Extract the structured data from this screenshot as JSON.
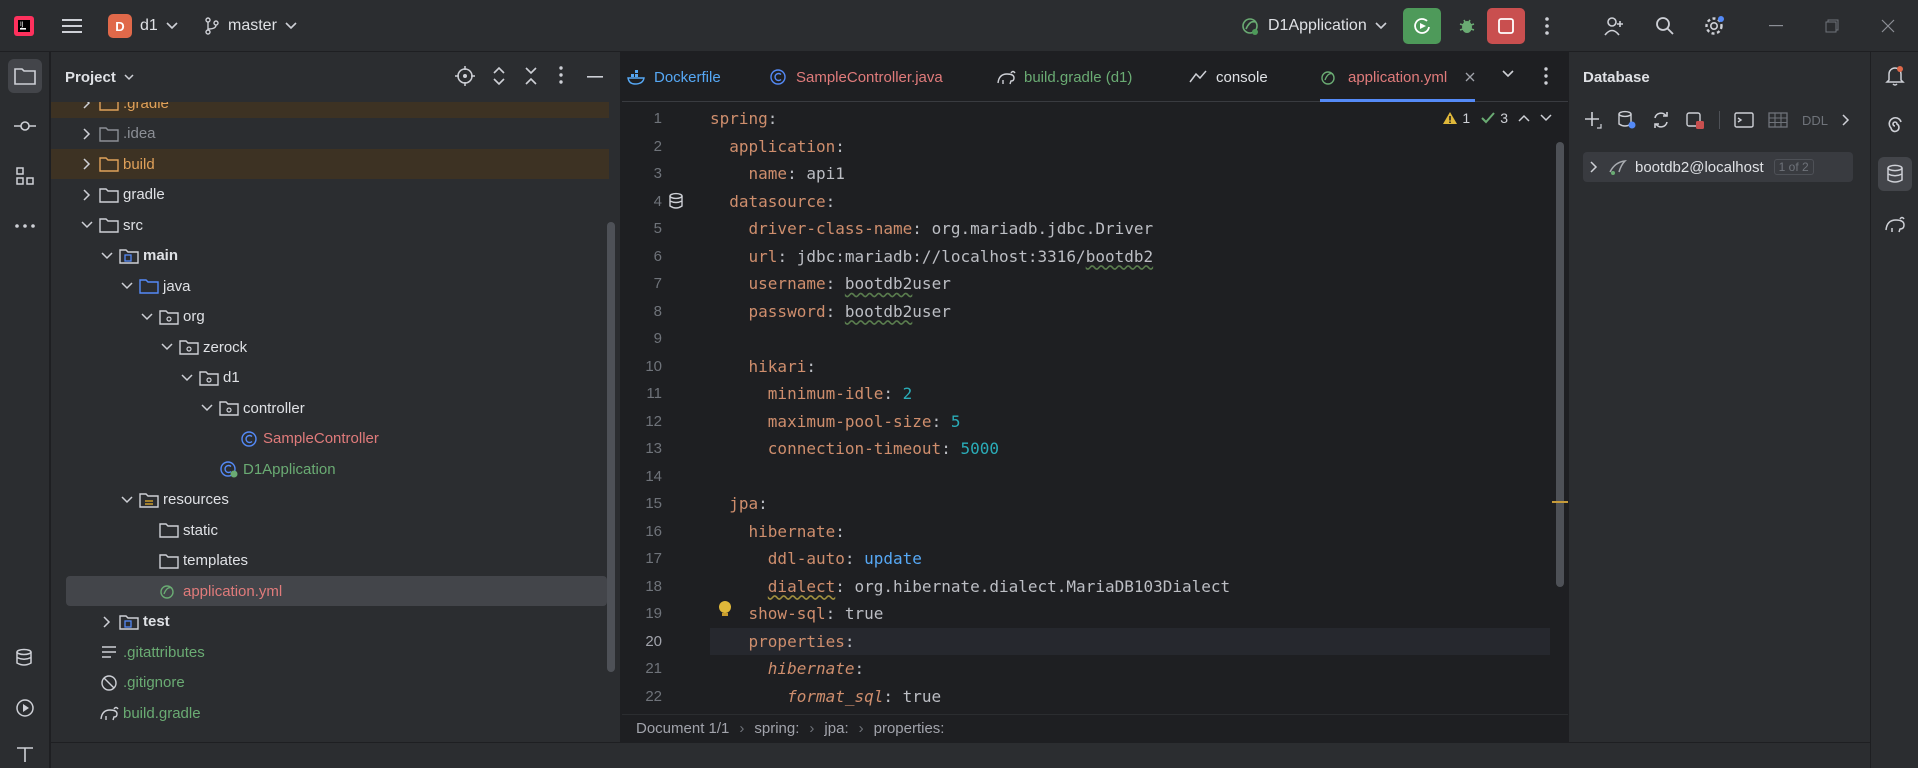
{
  "titlebar": {
    "project_initial": "D",
    "project_name": "d1",
    "branch": "master",
    "run_config": "D1Application"
  },
  "project_panel": {
    "title": "Project",
    "tree": [
      {
        "label": ".gradle",
        "depth": 1,
        "chevron": "right",
        "icon": "folder",
        "color": "#e0a15a",
        "excluded": true
      },
      {
        "label": ".idea",
        "depth": 1,
        "chevron": "right",
        "icon": "folder",
        "color": "#8c8f96"
      },
      {
        "label": "build",
        "depth": 1,
        "chevron": "right",
        "icon": "folder",
        "color": "#e0a15a",
        "excluded": true
      },
      {
        "label": "gradle",
        "depth": 1,
        "chevron": "right",
        "icon": "folder",
        "color": "#dfe1e5"
      },
      {
        "label": "src",
        "depth": 1,
        "chevron": "down",
        "icon": "folder",
        "color": "#dfe1e5"
      },
      {
        "label": "main",
        "depth": 2,
        "chevron": "down",
        "icon": "module-folder",
        "color": "#dfe1e5",
        "bold": true
      },
      {
        "label": "java",
        "depth": 3,
        "chevron": "down",
        "icon": "source-folder",
        "color": "#dfe1e5"
      },
      {
        "label": "org",
        "depth": 4,
        "chevron": "down",
        "icon": "package",
        "color": "#dfe1e5"
      },
      {
        "label": "zerock",
        "depth": 5,
        "chevron": "down",
        "icon": "package",
        "color": "#dfe1e5"
      },
      {
        "label": "d1",
        "depth": 6,
        "chevron": "down",
        "icon": "package",
        "color": "#dfe1e5"
      },
      {
        "label": "controller",
        "depth": 7,
        "chevron": "down",
        "icon": "package",
        "color": "#dfe1e5"
      },
      {
        "label": "SampleController",
        "depth": 8,
        "chevron": "none",
        "icon": "class",
        "color": "#e07b7b"
      },
      {
        "label": "D1Application",
        "depth": 7,
        "chevron": "none",
        "icon": "spring-class",
        "color": "#6aab73"
      },
      {
        "label": "resources",
        "depth": 3,
        "chevron": "down",
        "icon": "resources-folder",
        "color": "#dfe1e5"
      },
      {
        "label": "static",
        "depth": 4,
        "chevron": "none",
        "icon": "folder",
        "color": "#dfe1e5"
      },
      {
        "label": "templates",
        "depth": 4,
        "chevron": "none",
        "icon": "folder",
        "color": "#dfe1e5"
      },
      {
        "label": "application.yml",
        "depth": 4,
        "chevron": "none",
        "icon": "yaml",
        "color": "#e07b7b",
        "selected": true
      },
      {
        "label": "test",
        "depth": 2,
        "chevron": "right",
        "icon": "module-folder",
        "color": "#dfe1e5",
        "bold": true
      },
      {
        "label": ".gitattributes",
        "depth": 1,
        "chevron": "none",
        "icon": "text-file",
        "color": "#6aab73"
      },
      {
        "label": ".gitignore",
        "depth": 1,
        "chevron": "none",
        "icon": "ignore-file",
        "color": "#6aab73"
      },
      {
        "label": "build.gradle",
        "depth": 1,
        "chevron": "none",
        "icon": "gradle",
        "color": "#6aab73"
      }
    ]
  },
  "editor": {
    "tabs": [
      {
        "label": "Dockerfile",
        "icon": "docker-icon",
        "color": "#56a8f5"
      },
      {
        "label": "SampleController.java",
        "icon": "class-icon",
        "color": "#e07b7b"
      },
      {
        "label": "build.gradle (d1)",
        "icon": "gradle-icon",
        "color": "#6aab73"
      },
      {
        "label": "console",
        "icon": "console-icon",
        "color": "#dfe1e5"
      },
      {
        "label": "application.yml",
        "icon": "yaml-icon",
        "color": "#e07b7b",
        "active": true
      }
    ],
    "inspections": {
      "warnings": "1",
      "ok": "3"
    },
    "current_line": 20,
    "lines": [
      {
        "num": "1",
        "indent": 0,
        "key": "spring",
        "sep": ":",
        "value": ""
      },
      {
        "num": "2",
        "indent": 1,
        "key": "application",
        "sep": ":",
        "value": ""
      },
      {
        "num": "3",
        "indent": 2,
        "key": "name",
        "sep": ": ",
        "value": "api1"
      },
      {
        "num": "4",
        "indent": 1,
        "key": "datasource",
        "sep": ":",
        "value": ""
      },
      {
        "num": "5",
        "indent": 2,
        "key": "driver-class-name",
        "sep": ": ",
        "value": "org.mariadb.jdbc.Driver"
      },
      {
        "num": "6",
        "indent": 2,
        "key": "url",
        "sep": ": ",
        "value": "jdbc:mariadb://localhost:3316/bootdb2"
      },
      {
        "num": "7",
        "indent": 2,
        "key": "username",
        "sep": ": ",
        "value": "bootdb2user"
      },
      {
        "num": "8",
        "indent": 2,
        "key": "password",
        "sep": ": ",
        "value": "bootdb2user"
      },
      {
        "num": "9",
        "indent": 0,
        "key": "",
        "sep": "",
        "value": ""
      },
      {
        "num": "10",
        "indent": 2,
        "key": "hikari",
        "sep": ":",
        "value": ""
      },
      {
        "num": "11",
        "indent": 3,
        "key": "minimum-idle",
        "sep": ": ",
        "value": "2",
        "vtype": "num"
      },
      {
        "num": "12",
        "indent": 3,
        "key": "maximum-pool-size",
        "sep": ": ",
        "value": "5",
        "vtype": "num"
      },
      {
        "num": "13",
        "indent": 3,
        "key": "connection-timeout",
        "sep": ": ",
        "value": "5000",
        "vtype": "num"
      },
      {
        "num": "14",
        "indent": 0,
        "key": "",
        "sep": "",
        "value": ""
      },
      {
        "num": "15",
        "indent": 1,
        "key": "jpa",
        "sep": ":",
        "value": ""
      },
      {
        "num": "16",
        "indent": 2,
        "key": "hibernate",
        "sep": ":",
        "value": ""
      },
      {
        "num": "17",
        "indent": 3,
        "key": "ddl-auto",
        "sep": ": ",
        "value": "update",
        "vtype": "blue"
      },
      {
        "num": "18",
        "indent": 3,
        "key": "dialect",
        "sep": ": ",
        "value": "org.hibernate.dialect.MariaDB103Dialect",
        "keySquig": true
      },
      {
        "num": "19",
        "indent": 2,
        "key": "show-sql",
        "sep": ": ",
        "value": "true"
      },
      {
        "num": "20",
        "indent": 2,
        "key": "properties",
        "sep": ":",
        "value": ""
      },
      {
        "num": "21",
        "indent": 3,
        "key": "hibernate",
        "sep": ":",
        "value": "",
        "italic": true
      },
      {
        "num": "22",
        "indent": 4,
        "key": "format_sql",
        "sep": ": ",
        "value": "true",
        "italic": true
      }
    ],
    "breadcrumb": [
      "Document 1/1",
      "spring:",
      "jpa:",
      "properties:"
    ]
  },
  "database_panel": {
    "title": "Database",
    "toolbar_ddl": "DDL",
    "datasource": "bootdb2@localhost",
    "datasource_badge": "1 of 2"
  },
  "colors": {
    "accent": "#548af7",
    "run_button": "#4e9a5a",
    "stop_button": "#c94f4f"
  }
}
